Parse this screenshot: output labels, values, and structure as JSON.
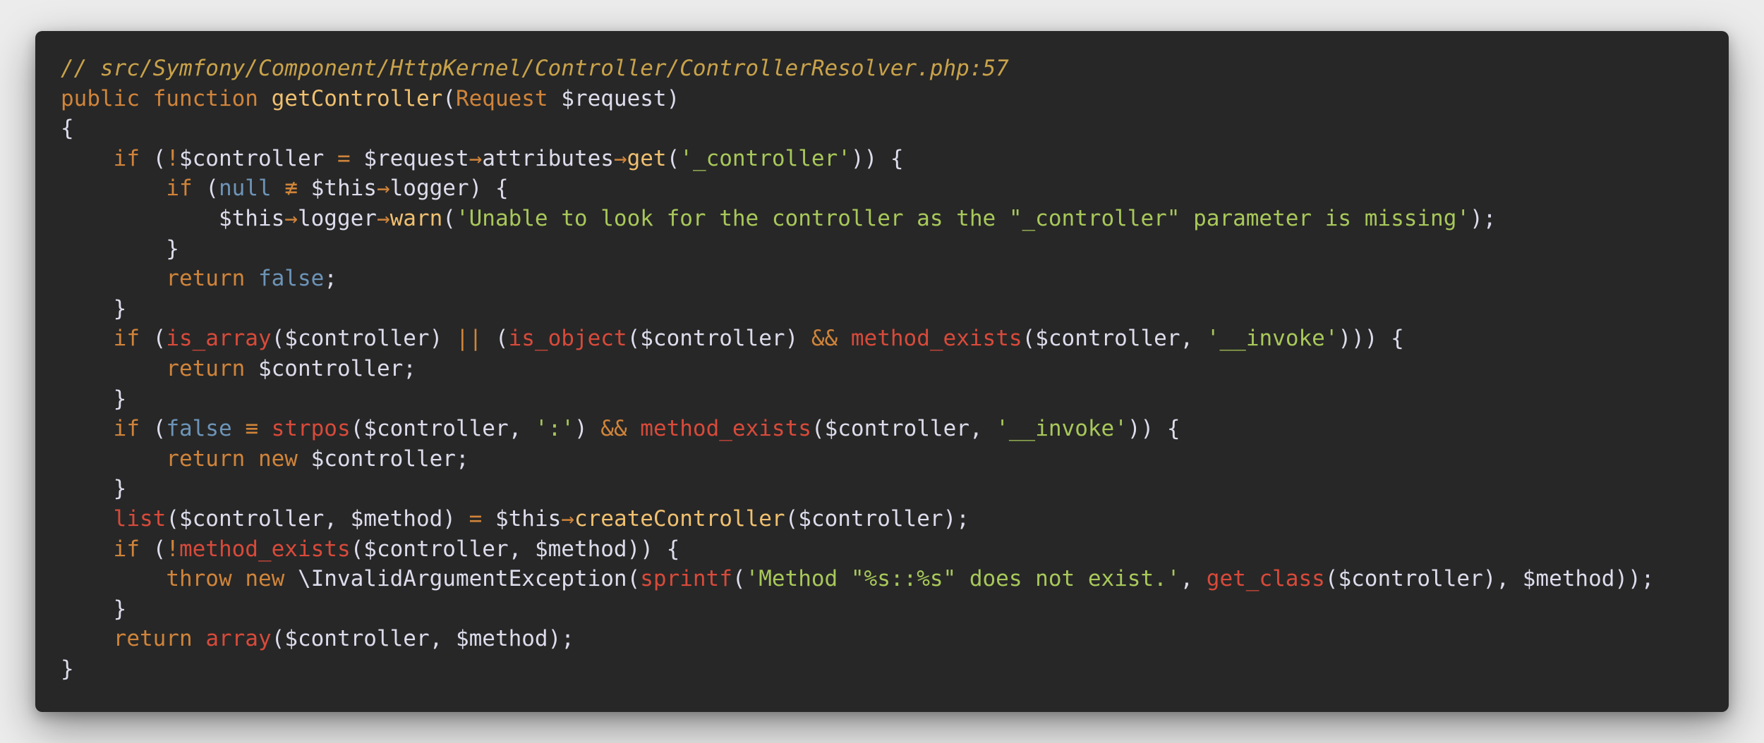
{
  "editor": {
    "colors": {
      "background": "#272727",
      "comment": "#c9a24a",
      "keyword": "#d0843a",
      "builtin": "#d84a3a",
      "function": "#f0c070",
      "string": "#a8c85a",
      "constant": "#6d94b8",
      "text": "#dcdcec"
    },
    "lines": [
      [
        [
          "comment",
          "// src/Symfony/Component/HttpKernel/Controller/ControllerResolver.php:57"
        ]
      ],
      [
        [
          "keyword",
          "public"
        ],
        [
          "plain",
          " "
        ],
        [
          "keyword",
          "function"
        ],
        [
          "plain",
          " "
        ],
        [
          "function",
          "getController"
        ],
        [
          "plain",
          "("
        ],
        [
          "keyword",
          "Request"
        ],
        [
          "plain",
          " "
        ],
        [
          "variable",
          "$request"
        ],
        [
          "plain",
          ")"
        ]
      ],
      [
        [
          "plain",
          "{"
        ]
      ],
      [
        [
          "plain",
          "    "
        ],
        [
          "keyword",
          "if"
        ],
        [
          "plain",
          " ("
        ],
        [
          "operator",
          "!"
        ],
        [
          "variable",
          "$controller"
        ],
        [
          "plain",
          " "
        ],
        [
          "operator",
          "="
        ],
        [
          "plain",
          " "
        ],
        [
          "variable",
          "$request"
        ],
        [
          "operator",
          "→"
        ],
        [
          "plain",
          "attributes"
        ],
        [
          "operator",
          "→"
        ],
        [
          "function",
          "get"
        ],
        [
          "plain",
          "("
        ],
        [
          "string",
          "'_controller'"
        ],
        [
          "plain",
          ")) {"
        ]
      ],
      [
        [
          "plain",
          "        "
        ],
        [
          "keyword",
          "if"
        ],
        [
          "plain",
          " ("
        ],
        [
          "constant",
          "null"
        ],
        [
          "plain",
          " "
        ],
        [
          "operator",
          "≢"
        ],
        [
          "plain",
          " "
        ],
        [
          "variable",
          "$this"
        ],
        [
          "operator",
          "→"
        ],
        [
          "plain",
          "logger) {"
        ]
      ],
      [
        [
          "plain",
          "            "
        ],
        [
          "variable",
          "$this"
        ],
        [
          "operator",
          "→"
        ],
        [
          "plain",
          "logger"
        ],
        [
          "operator",
          "→"
        ],
        [
          "function",
          "warn"
        ],
        [
          "plain",
          "("
        ],
        [
          "string",
          "'Unable to look for the controller as the \"_controller\" parameter is missing'"
        ],
        [
          "plain",
          ");"
        ]
      ],
      [
        [
          "plain",
          "        }"
        ]
      ],
      [
        [
          "plain",
          "        "
        ],
        [
          "keyword",
          "return"
        ],
        [
          "plain",
          " "
        ],
        [
          "constant",
          "false"
        ],
        [
          "plain",
          ";"
        ]
      ],
      [
        [
          "plain",
          "    }"
        ]
      ],
      [
        [
          "plain",
          "    "
        ],
        [
          "keyword",
          "if"
        ],
        [
          "plain",
          " ("
        ],
        [
          "builtin",
          "is_array"
        ],
        [
          "plain",
          "("
        ],
        [
          "variable",
          "$controller"
        ],
        [
          "plain",
          ") "
        ],
        [
          "operator",
          "||"
        ],
        [
          "plain",
          " ("
        ],
        [
          "builtin",
          "is_object"
        ],
        [
          "plain",
          "("
        ],
        [
          "variable",
          "$controller"
        ],
        [
          "plain",
          ") "
        ],
        [
          "operator",
          "&&"
        ],
        [
          "plain",
          " "
        ],
        [
          "builtin",
          "method_exists"
        ],
        [
          "plain",
          "("
        ],
        [
          "variable",
          "$controller"
        ],
        [
          "plain",
          ", "
        ],
        [
          "string",
          "'__invoke'"
        ],
        [
          "plain",
          "))) {"
        ]
      ],
      [
        [
          "plain",
          "        "
        ],
        [
          "keyword",
          "return"
        ],
        [
          "plain",
          " "
        ],
        [
          "variable",
          "$controller"
        ],
        [
          "plain",
          ";"
        ]
      ],
      [
        [
          "plain",
          "    }"
        ]
      ],
      [
        [
          "plain",
          "    "
        ],
        [
          "keyword",
          "if"
        ],
        [
          "plain",
          " ("
        ],
        [
          "constant",
          "false"
        ],
        [
          "plain",
          " "
        ],
        [
          "operator",
          "≡"
        ],
        [
          "plain",
          " "
        ],
        [
          "builtin",
          "strpos"
        ],
        [
          "plain",
          "("
        ],
        [
          "variable",
          "$controller"
        ],
        [
          "plain",
          ", "
        ],
        [
          "string",
          "':'"
        ],
        [
          "plain",
          ") "
        ],
        [
          "operator",
          "&&"
        ],
        [
          "plain",
          " "
        ],
        [
          "builtin",
          "method_exists"
        ],
        [
          "plain",
          "("
        ],
        [
          "variable",
          "$controller"
        ],
        [
          "plain",
          ", "
        ],
        [
          "string",
          "'__invoke'"
        ],
        [
          "plain",
          ")) {"
        ]
      ],
      [
        [
          "plain",
          "        "
        ],
        [
          "keyword",
          "return"
        ],
        [
          "plain",
          " "
        ],
        [
          "keyword",
          "new"
        ],
        [
          "plain",
          " "
        ],
        [
          "variable",
          "$controller"
        ],
        [
          "plain",
          ";"
        ]
      ],
      [
        [
          "plain",
          "    }"
        ]
      ],
      [
        [
          "plain",
          "    "
        ],
        [
          "builtin",
          "list"
        ],
        [
          "plain",
          "("
        ],
        [
          "variable",
          "$controller"
        ],
        [
          "plain",
          ", "
        ],
        [
          "variable",
          "$method"
        ],
        [
          "plain",
          ") "
        ],
        [
          "operator",
          "="
        ],
        [
          "plain",
          " "
        ],
        [
          "variable",
          "$this"
        ],
        [
          "operator",
          "→"
        ],
        [
          "function",
          "createController"
        ],
        [
          "plain",
          "("
        ],
        [
          "variable",
          "$controller"
        ],
        [
          "plain",
          ");"
        ]
      ],
      [
        [
          "plain",
          "    "
        ],
        [
          "keyword",
          "if"
        ],
        [
          "plain",
          " ("
        ],
        [
          "operator",
          "!"
        ],
        [
          "builtin",
          "method_exists"
        ],
        [
          "plain",
          "("
        ],
        [
          "variable",
          "$controller"
        ],
        [
          "plain",
          ", "
        ],
        [
          "variable",
          "$method"
        ],
        [
          "plain",
          ")) {"
        ]
      ],
      [
        [
          "plain",
          "        "
        ],
        [
          "keyword",
          "throw"
        ],
        [
          "plain",
          " "
        ],
        [
          "keyword",
          "new"
        ],
        [
          "plain",
          " \\InvalidArgumentException("
        ],
        [
          "builtin",
          "sprintf"
        ],
        [
          "plain",
          "("
        ],
        [
          "string",
          "'Method \"%s::%s\" does not exist.'"
        ],
        [
          "plain",
          ", "
        ],
        [
          "builtin",
          "get_class"
        ],
        [
          "plain",
          "("
        ],
        [
          "variable",
          "$controller"
        ],
        [
          "plain",
          "), "
        ],
        [
          "variable",
          "$method"
        ],
        [
          "plain",
          "));"
        ]
      ],
      [
        [
          "plain",
          "    }"
        ]
      ],
      [
        [
          "plain",
          "    "
        ],
        [
          "keyword",
          "return"
        ],
        [
          "plain",
          " "
        ],
        [
          "builtin",
          "array"
        ],
        [
          "plain",
          "("
        ],
        [
          "variable",
          "$controller"
        ],
        [
          "plain",
          ", "
        ],
        [
          "variable",
          "$method"
        ],
        [
          "plain",
          ");"
        ]
      ],
      [
        [
          "plain",
          "}"
        ]
      ]
    ]
  }
}
